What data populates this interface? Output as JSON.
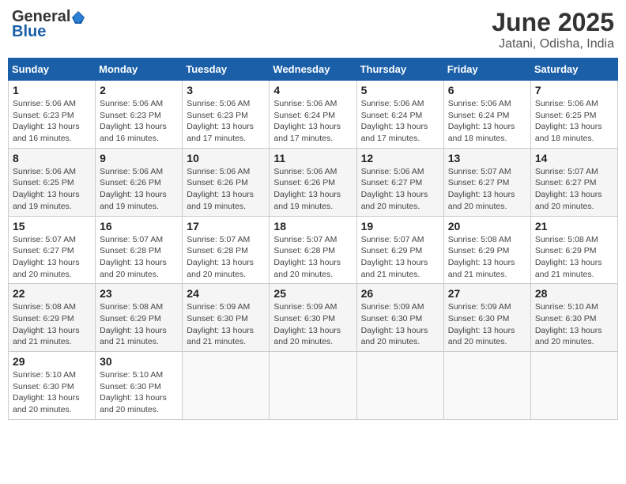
{
  "header": {
    "logo_general": "General",
    "logo_blue": "Blue",
    "month_title": "June 2025",
    "location": "Jatani, Odisha, India"
  },
  "weekdays": [
    "Sunday",
    "Monday",
    "Tuesday",
    "Wednesday",
    "Thursday",
    "Friday",
    "Saturday"
  ],
  "weeks": [
    [
      {
        "day": "1",
        "sunrise": "5:06 AM",
        "sunset": "6:23 PM",
        "daylight": "13 hours and 16 minutes."
      },
      {
        "day": "2",
        "sunrise": "5:06 AM",
        "sunset": "6:23 PM",
        "daylight": "13 hours and 16 minutes."
      },
      {
        "day": "3",
        "sunrise": "5:06 AM",
        "sunset": "6:23 PM",
        "daylight": "13 hours and 17 minutes."
      },
      {
        "day": "4",
        "sunrise": "5:06 AM",
        "sunset": "6:24 PM",
        "daylight": "13 hours and 17 minutes."
      },
      {
        "day": "5",
        "sunrise": "5:06 AM",
        "sunset": "6:24 PM",
        "daylight": "13 hours and 17 minutes."
      },
      {
        "day": "6",
        "sunrise": "5:06 AM",
        "sunset": "6:24 PM",
        "daylight": "13 hours and 18 minutes."
      },
      {
        "day": "7",
        "sunrise": "5:06 AM",
        "sunset": "6:25 PM",
        "daylight": "13 hours and 18 minutes."
      }
    ],
    [
      {
        "day": "8",
        "sunrise": "5:06 AM",
        "sunset": "6:25 PM",
        "daylight": "13 hours and 19 minutes."
      },
      {
        "day": "9",
        "sunrise": "5:06 AM",
        "sunset": "6:26 PM",
        "daylight": "13 hours and 19 minutes."
      },
      {
        "day": "10",
        "sunrise": "5:06 AM",
        "sunset": "6:26 PM",
        "daylight": "13 hours and 19 minutes."
      },
      {
        "day": "11",
        "sunrise": "5:06 AM",
        "sunset": "6:26 PM",
        "daylight": "13 hours and 19 minutes."
      },
      {
        "day": "12",
        "sunrise": "5:06 AM",
        "sunset": "6:27 PM",
        "daylight": "13 hours and 20 minutes."
      },
      {
        "day": "13",
        "sunrise": "5:07 AM",
        "sunset": "6:27 PM",
        "daylight": "13 hours and 20 minutes."
      },
      {
        "day": "14",
        "sunrise": "5:07 AM",
        "sunset": "6:27 PM",
        "daylight": "13 hours and 20 minutes."
      }
    ],
    [
      {
        "day": "15",
        "sunrise": "5:07 AM",
        "sunset": "6:27 PM",
        "daylight": "13 hours and 20 minutes."
      },
      {
        "day": "16",
        "sunrise": "5:07 AM",
        "sunset": "6:28 PM",
        "daylight": "13 hours and 20 minutes."
      },
      {
        "day": "17",
        "sunrise": "5:07 AM",
        "sunset": "6:28 PM",
        "daylight": "13 hours and 20 minutes."
      },
      {
        "day": "18",
        "sunrise": "5:07 AM",
        "sunset": "6:28 PM",
        "daylight": "13 hours and 20 minutes."
      },
      {
        "day": "19",
        "sunrise": "5:07 AM",
        "sunset": "6:29 PM",
        "daylight": "13 hours and 21 minutes."
      },
      {
        "day": "20",
        "sunrise": "5:08 AM",
        "sunset": "6:29 PM",
        "daylight": "13 hours and 21 minutes."
      },
      {
        "day": "21",
        "sunrise": "5:08 AM",
        "sunset": "6:29 PM",
        "daylight": "13 hours and 21 minutes."
      }
    ],
    [
      {
        "day": "22",
        "sunrise": "5:08 AM",
        "sunset": "6:29 PM",
        "daylight": "13 hours and 21 minutes."
      },
      {
        "day": "23",
        "sunrise": "5:08 AM",
        "sunset": "6:29 PM",
        "daylight": "13 hours and 21 minutes."
      },
      {
        "day": "24",
        "sunrise": "5:09 AM",
        "sunset": "6:30 PM",
        "daylight": "13 hours and 21 minutes."
      },
      {
        "day": "25",
        "sunrise": "5:09 AM",
        "sunset": "6:30 PM",
        "daylight": "13 hours and 20 minutes."
      },
      {
        "day": "26",
        "sunrise": "5:09 AM",
        "sunset": "6:30 PM",
        "daylight": "13 hours and 20 minutes."
      },
      {
        "day": "27",
        "sunrise": "5:09 AM",
        "sunset": "6:30 PM",
        "daylight": "13 hours and 20 minutes."
      },
      {
        "day": "28",
        "sunrise": "5:10 AM",
        "sunset": "6:30 PM",
        "daylight": "13 hours and 20 minutes."
      }
    ],
    [
      {
        "day": "29",
        "sunrise": "5:10 AM",
        "sunset": "6:30 PM",
        "daylight": "13 hours and 20 minutes."
      },
      {
        "day": "30",
        "sunrise": "5:10 AM",
        "sunset": "6:30 PM",
        "daylight": "13 hours and 20 minutes."
      },
      null,
      null,
      null,
      null,
      null
    ]
  ]
}
